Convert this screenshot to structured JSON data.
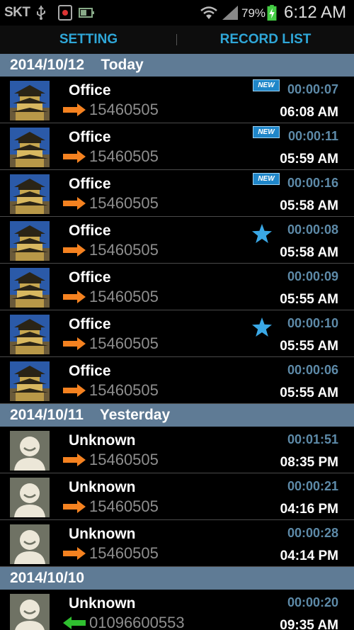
{
  "statusbar": {
    "carrier": "SKT",
    "battery": "79%",
    "time": "6:12 AM"
  },
  "tabs": [
    {
      "label": "SETTING"
    },
    {
      "label": "RECORD LIST"
    }
  ],
  "sections": [
    {
      "header": "2014/10/12    Today",
      "rows": [
        {
          "name": "Office",
          "number": "15460505",
          "duration": "00:00:07",
          "time": "06:08 AM",
          "badge": "NEW",
          "thumb": "building",
          "direction": "out"
        },
        {
          "name": "Office",
          "number": "15460505",
          "duration": "00:00:11",
          "time": "05:59 AM",
          "badge": "NEW",
          "thumb": "building",
          "direction": "out"
        },
        {
          "name": "Office",
          "number": "15460505",
          "duration": "00:00:16",
          "time": "05:58 AM",
          "badge": "NEW",
          "thumb": "building",
          "direction": "out"
        },
        {
          "name": "Office",
          "number": "15460505",
          "duration": "00:00:08",
          "time": "05:58 AM",
          "badge": "star",
          "thumb": "building",
          "direction": "out"
        },
        {
          "name": "Office",
          "number": "15460505",
          "duration": "00:00:09",
          "time": "05:55 AM",
          "badge": "",
          "thumb": "building",
          "direction": "out"
        },
        {
          "name": "Office",
          "number": "15460505",
          "duration": "00:00:10",
          "time": "05:55 AM",
          "badge": "star",
          "thumb": "building",
          "direction": "out"
        },
        {
          "name": "Office",
          "number": "15460505",
          "duration": "00:00:06",
          "time": "05:55 AM",
          "badge": "",
          "thumb": "building",
          "direction": "out"
        }
      ]
    },
    {
      "header": "2014/10/11    Yesterday",
      "rows": [
        {
          "name": "Unknown",
          "number": "15460505",
          "duration": "00:01:51",
          "time": "08:35 PM",
          "badge": "",
          "thumb": "person",
          "direction": "out"
        },
        {
          "name": "Unknown",
          "number": "15460505",
          "duration": "00:00:21",
          "time": "04:16 PM",
          "badge": "",
          "thumb": "person",
          "direction": "out"
        },
        {
          "name": "Unknown",
          "number": "15460505",
          "duration": "00:00:28",
          "time": "04:14 PM",
          "badge": "",
          "thumb": "person",
          "direction": "out"
        }
      ]
    },
    {
      "header": "2014/10/10",
      "rows": [
        {
          "name": "Unknown",
          "number": "01096600553",
          "duration": "00:00:20",
          "time": "09:35 AM",
          "badge": "",
          "thumb": "person",
          "direction": "in"
        }
      ]
    }
  ],
  "colors": {
    "accent": "#2fa7d8",
    "section": "#5f7b95",
    "duration": "#5d8aa8",
    "out_arrow": "#f58220",
    "in_arrow": "#2fbf2f"
  },
  "icons": [
    "usb-icon",
    "call-record-icon",
    "battery-small-icon",
    "wifi-icon",
    "signal-icon",
    "battery-charging-icon",
    "outgoing-arrow-icon",
    "incoming-arrow-icon",
    "star-icon",
    "new-badge-icon"
  ]
}
